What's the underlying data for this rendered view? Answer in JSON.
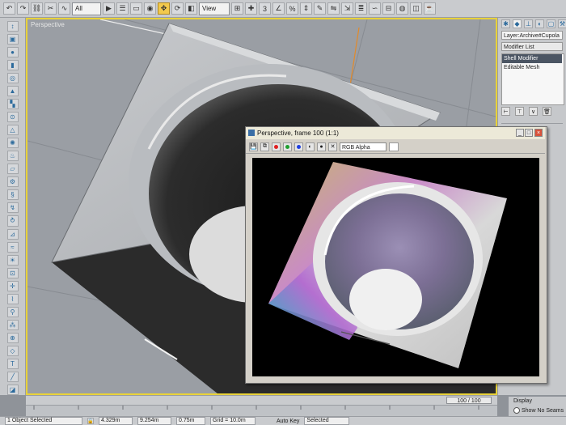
{
  "main_toolbar": {
    "selection_filter": "All",
    "ref_coord": "View"
  },
  "viewport": {
    "label": "Perspective"
  },
  "command_panel": {
    "object_name": "Layer:Archive#Cupola",
    "modifier_list": "Modifier List",
    "stack_items": [
      "Shell Modifier",
      "Editable Mesh"
    ]
  },
  "render_window": {
    "title": "Perspective, frame 100 (1:1)",
    "channel": "RGB Alpha",
    "minimize": "_",
    "maximize": "□",
    "close": "×"
  },
  "time_slider": {
    "value": "100 / 100"
  },
  "status_bar": {
    "selection": "1 Object Selected",
    "x": "4.329m",
    "y": "9.254m",
    "z": "0.75m",
    "grid": "Grid = 10.0m",
    "auto_key": "Auto Key",
    "key_mode": "Selected"
  },
  "display_group": {
    "title": "Display",
    "option": "Show No Seams"
  },
  "colors": {
    "viewport_border": "#e8d23a",
    "active_tool": "#f2c94c",
    "close_button": "#d9533b"
  }
}
